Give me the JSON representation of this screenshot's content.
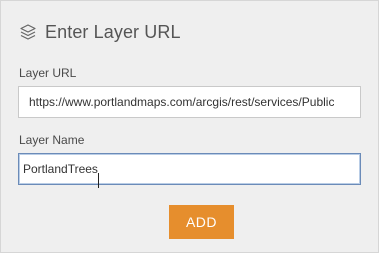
{
  "header": {
    "title": "Enter Layer URL",
    "icon": "layers-icon"
  },
  "layer_url": {
    "label": "Layer URL",
    "value": "https://www.portlandmaps.com/arcgis/rest/services/Public"
  },
  "layer_name": {
    "label": "Layer Name",
    "value": "PortlandTrees"
  },
  "add_button": {
    "label": "ADD"
  },
  "colors": {
    "accent": "#e68e2d",
    "panel_bg": "#efefef",
    "focus_border": "#6b8bb8"
  }
}
